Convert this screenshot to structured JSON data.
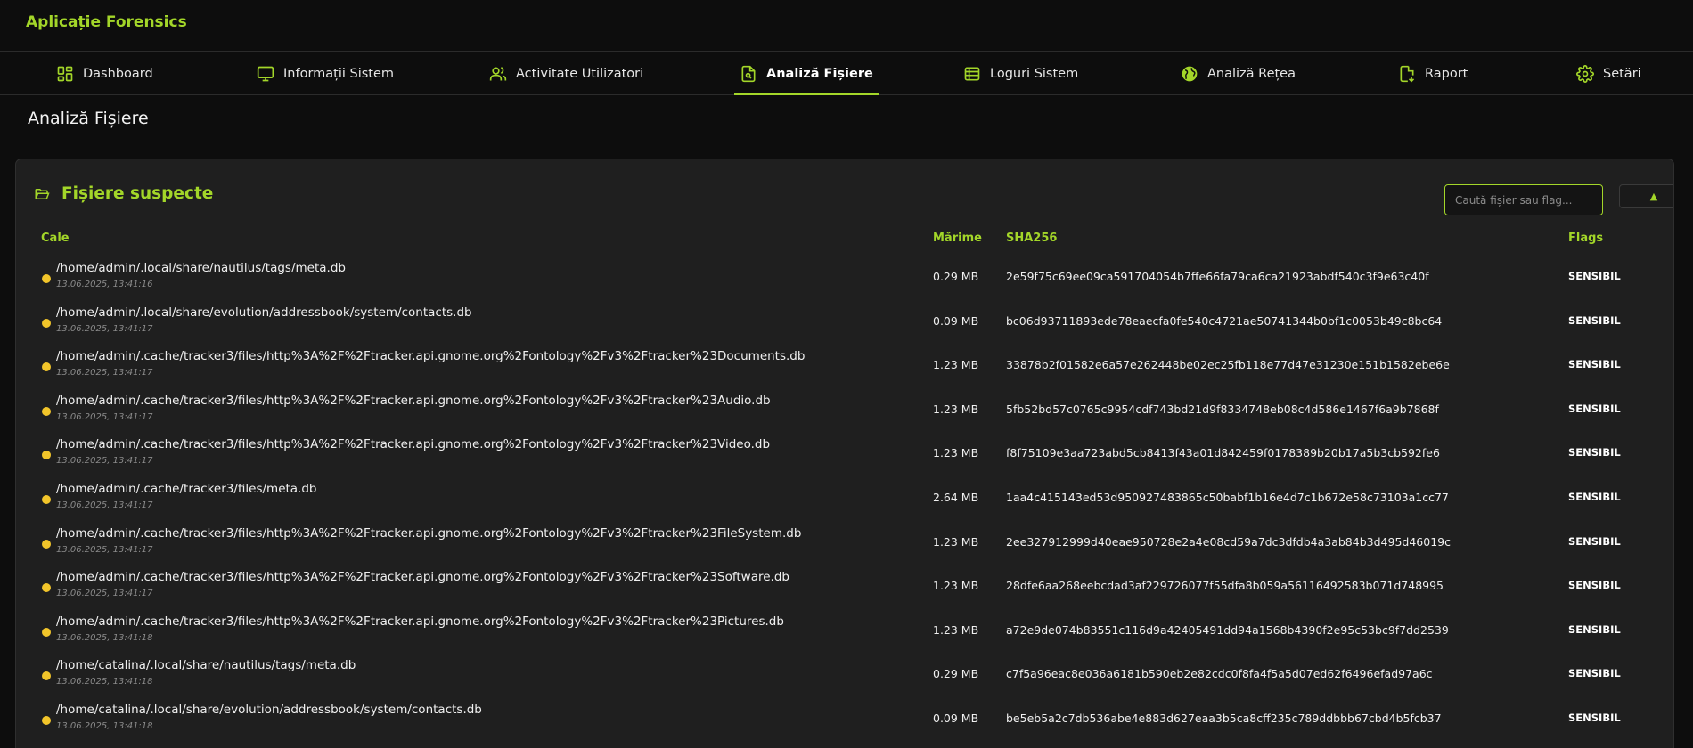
{
  "app": {
    "title": "Aplicație Forensics"
  },
  "nav": {
    "items": [
      {
        "label": "Dashboard",
        "icon": "dashboard-grid-icon"
      },
      {
        "label": "Informații Sistem",
        "icon": "monitor-icon"
      },
      {
        "label": "Activitate Utilizatori",
        "icon": "users-icon"
      },
      {
        "label": "Analiză Fișiere",
        "icon": "file-search-icon",
        "active": true
      },
      {
        "label": "Loguri Sistem",
        "icon": "table-list-icon"
      },
      {
        "label": "Analiză Rețea",
        "icon": "globe-icon"
      },
      {
        "label": "Raport",
        "icon": "file-download-icon"
      },
      {
        "label": "Setări",
        "icon": "gear-icon"
      }
    ]
  },
  "page": {
    "title": "Analiză Fișiere"
  },
  "card": {
    "title": "Fișiere suspecte",
    "icon": "folder-open-icon",
    "search_placeholder": "Caută fișier sau flag...",
    "collapse_symbol": "▲"
  },
  "table": {
    "headers": {
      "path": "Cale",
      "size": "Mărime",
      "hash": "SHA256",
      "flags": "Flags"
    },
    "rows": [
      {
        "path": "/home/admin/.local/share/nautilus/tags/meta.db",
        "timestamp": "13.06.2025, 13:41:16",
        "size": "0.29 MB",
        "sha256": "2e59f75c69ee09ca591704054b7ffe66fa79ca6ca21923abdf540c3f9e63c40f",
        "flag": "SENSIBIL"
      },
      {
        "path": "/home/admin/.local/share/evolution/addressbook/system/contacts.db",
        "timestamp": "13.06.2025, 13:41:17",
        "size": "0.09 MB",
        "sha256": "bc06d93711893ede78eaecfa0fe540c4721ae50741344b0bf1c0053b49c8bc64",
        "flag": "SENSIBIL"
      },
      {
        "path": "/home/admin/.cache/tracker3/files/http%3A%2F%2Ftracker.api.gnome.org%2Fontology%2Fv3%2Ftracker%23Documents.db",
        "timestamp": "13.06.2025, 13:41:17",
        "size": "1.23 MB",
        "sha256": "33878b2f01582e6a57e262448be02ec25fb118e77d47e31230e151b1582ebe6e",
        "flag": "SENSIBIL"
      },
      {
        "path": "/home/admin/.cache/tracker3/files/http%3A%2F%2Ftracker.api.gnome.org%2Fontology%2Fv3%2Ftracker%23Audio.db",
        "timestamp": "13.06.2025, 13:41:17",
        "size": "1.23 MB",
        "sha256": "5fb52bd57c0765c9954cdf743bd21d9f8334748eb08c4d586e1467f6a9b7868f",
        "flag": "SENSIBIL"
      },
      {
        "path": "/home/admin/.cache/tracker3/files/http%3A%2F%2Ftracker.api.gnome.org%2Fontology%2Fv3%2Ftracker%23Video.db",
        "timestamp": "13.06.2025, 13:41:17",
        "size": "1.23 MB",
        "sha256": "f8f75109e3aa723abd5cb8413f43a01d842459f0178389b20b17a5b3cb592fe6",
        "flag": "SENSIBIL"
      },
      {
        "path": "/home/admin/.cache/tracker3/files/meta.db",
        "timestamp": "13.06.2025, 13:41:17",
        "size": "2.64 MB",
        "sha256": "1aa4c415143ed53d950927483865c50babf1b16e4d7c1b672e58c73103a1cc77",
        "flag": "SENSIBIL"
      },
      {
        "path": "/home/admin/.cache/tracker3/files/http%3A%2F%2Ftracker.api.gnome.org%2Fontology%2Fv3%2Ftracker%23FileSystem.db",
        "timestamp": "13.06.2025, 13:41:17",
        "size": "1.23 MB",
        "sha256": "2ee327912999d40eae950728e2a4e08cd59a7dc3dfdb4a3ab84b3d495d46019c",
        "flag": "SENSIBIL"
      },
      {
        "path": "/home/admin/.cache/tracker3/files/http%3A%2F%2Ftracker.api.gnome.org%2Fontology%2Fv3%2Ftracker%23Software.db",
        "timestamp": "13.06.2025, 13:41:17",
        "size": "1.23 MB",
        "sha256": "28dfe6aa268eebcdad3af229726077f55dfa8b059a56116492583b071d748995",
        "flag": "SENSIBIL"
      },
      {
        "path": "/home/admin/.cache/tracker3/files/http%3A%2F%2Ftracker.api.gnome.org%2Fontology%2Fv3%2Ftracker%23Pictures.db",
        "timestamp": "13.06.2025, 13:41:18",
        "size": "1.23 MB",
        "sha256": "a72e9de074b83551c116d9a42405491dd94a1568b4390f2e95c53bc9f7dd2539",
        "flag": "SENSIBIL"
      },
      {
        "path": "/home/catalina/.local/share/nautilus/tags/meta.db",
        "timestamp": "13.06.2025, 13:41:18",
        "size": "0.29 MB",
        "sha256": "c7f5a96eac8e036a6181b590eb2e82cdc0f8fa4f5a5d07ed62f6496efad97a6c",
        "flag": "SENSIBIL"
      },
      {
        "path": "/home/catalina/.local/share/evolution/addressbook/system/contacts.db",
        "timestamp": "13.06.2025, 13:41:18",
        "size": "0.09 MB",
        "sha256": "be5eb5a2c7db536abe4e883d627eaa3b5ca8cff235c789ddbbb67cbd4b5fcb37",
        "flag": "SENSIBIL"
      }
    ]
  },
  "colors": {
    "accent": "#a3d629",
    "background": "#0d0d0d",
    "card": "#1f1f1f",
    "status_dot": "#f2c52a"
  }
}
